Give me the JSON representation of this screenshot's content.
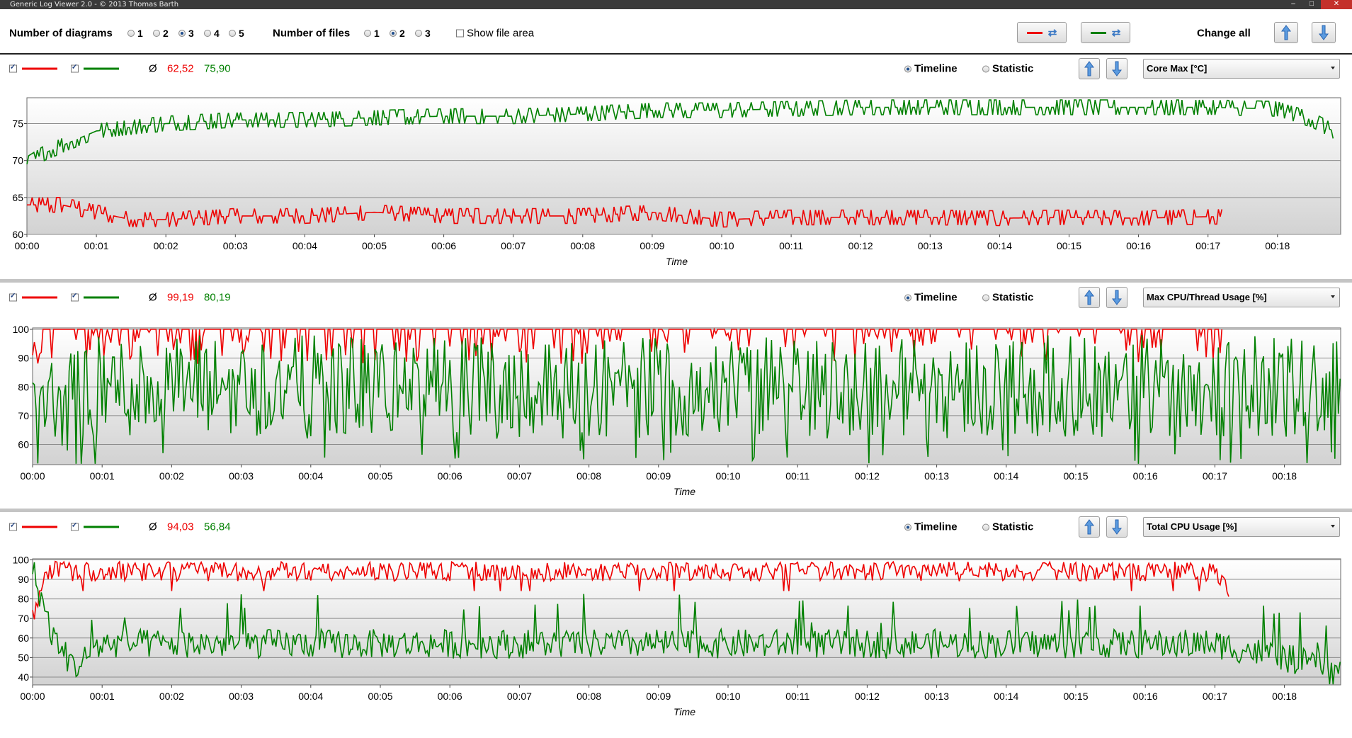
{
  "window": {
    "title": "Generic Log Viewer 2.0 - © 2013 Thomas Barth",
    "minimize": "–",
    "maximize": "□",
    "close": "✕"
  },
  "toolbar": {
    "diagrams_label": "Number of diagrams",
    "diagram_options": [
      "1",
      "2",
      "3",
      "4",
      "5"
    ],
    "diagrams_selected": "3",
    "files_label": "Number of files",
    "file_options": [
      "1",
      "2",
      "3"
    ],
    "files_selected": "2",
    "show_file_area_label": "Show file area",
    "change_all_label": "Change all"
  },
  "colors": {
    "file1": "#ee0000",
    "file2": "#008000",
    "accent": "#3a78c4"
  },
  "panels": [
    {
      "avg_symbol": "Ø",
      "avg1": "62,52",
      "avg2": "75,90",
      "timeline_label": "Timeline",
      "statistic_label": "Statistic",
      "selected_view": "Timeline",
      "metric": "Core Max [°C]",
      "xlabel": "Time"
    },
    {
      "avg_symbol": "Ø",
      "avg1": "99,19",
      "avg2": "80,19",
      "timeline_label": "Timeline",
      "statistic_label": "Statistic",
      "selected_view": "Timeline",
      "metric": "Max CPU/Thread Usage [%]",
      "xlabel": "Time"
    },
    {
      "avg_symbol": "Ø",
      "avg1": "94,03",
      "avg2": "56,84",
      "timeline_label": "Timeline",
      "statistic_label": "Statistic",
      "selected_view": "Timeline",
      "metric": "Total CPU Usage [%]",
      "xlabel": "Time"
    }
  ],
  "chart_data": [
    {
      "type": "line",
      "xlabel": "Time",
      "x_ticks": [
        "00:00",
        "00:01",
        "00:02",
        "00:03",
        "00:04",
        "00:05",
        "00:06",
        "00:07",
        "00:08",
        "00:09",
        "00:10",
        "00:11",
        "00:12",
        "00:13",
        "00:14",
        "00:15",
        "00:16",
        "00:17",
        "00:18"
      ],
      "ylim": [
        60,
        78.5
      ],
      "y_ticks": [
        60,
        65,
        70,
        75
      ],
      "series": [
        {
          "color": "#ee0000",
          "x_minutes": [
            0,
            0.5,
            1,
            1.5,
            2,
            3,
            4,
            5,
            6,
            7,
            8,
            9,
            10,
            11,
            12,
            13,
            14,
            15,
            16,
            17,
            17.2
          ],
          "values": [
            64,
            64,
            63,
            62,
            62,
            62.5,
            62.5,
            63,
            62.5,
            62.5,
            62.5,
            63,
            62,
            62.3,
            62.3,
            62.3,
            62.2,
            62.3,
            62.2,
            62.4,
            62.4
          ]
        },
        {
          "color": "#008000",
          "x_minutes": [
            0,
            0.25,
            0.5,
            0.75,
            1,
            1.5,
            2,
            3,
            4,
            5,
            6,
            7,
            8,
            9,
            10,
            11,
            12,
            13,
            14,
            15,
            16,
            17,
            18,
            18.5,
            18.8
          ],
          "values": [
            69.5,
            71,
            72,
            73,
            74,
            74.5,
            75,
            75.5,
            75.5,
            75.8,
            76,
            76,
            76.3,
            76.8,
            76.8,
            77,
            77.2,
            77.2,
            77.2,
            77.2,
            77.2,
            77.2,
            77,
            75.5,
            74
          ]
        }
      ]
    },
    {
      "type": "line",
      "xlabel": "Time",
      "x_ticks": [
        "00:00",
        "00:01",
        "00:02",
        "00:03",
        "00:04",
        "00:05",
        "00:06",
        "00:07",
        "00:08",
        "00:09",
        "00:10",
        "00:11",
        "00:12",
        "00:13",
        "00:14",
        "00:15",
        "00:16",
        "00:17",
        "00:18"
      ],
      "ylim": [
        53,
        100.5
      ],
      "y_ticks": [
        60,
        70,
        80,
        90,
        100
      ],
      "series": [
        {
          "color": "#ee0000",
          "x_minutes": [
            0,
            0.1,
            0.3,
            1,
            2,
            3,
            4,
            5,
            6,
            7,
            8,
            9,
            10,
            11,
            12,
            13,
            14,
            15,
            16,
            17,
            17.1
          ],
          "values": [
            82,
            95,
            100,
            99,
            99,
            99,
            99,
            99,
            99,
            99,
            99,
            99,
            99,
            99,
            99,
            99,
            99,
            99,
            99,
            99,
            94
          ]
        },
        {
          "color": "#008000",
          "x_minutes": [
            0,
            1,
            2,
            3,
            4,
            5,
            6,
            7,
            8,
            9,
            10,
            11,
            12,
            13,
            14,
            15,
            16,
            17,
            18,
            18.8
          ],
          "values": [
            70,
            80,
            80,
            80,
            80,
            80,
            80,
            80,
            80,
            80,
            80,
            80,
            80,
            80,
            80,
            80,
            80,
            80,
            80,
            80
          ]
        }
      ]
    },
    {
      "type": "line",
      "xlabel": "Time",
      "x_ticks": [
        "00:00",
        "00:01",
        "00:02",
        "00:03",
        "00:04",
        "00:05",
        "00:06",
        "00:07",
        "00:08",
        "00:09",
        "00:10",
        "00:11",
        "00:12",
        "00:13",
        "00:14",
        "00:15",
        "00:16",
        "00:17",
        "00:18"
      ],
      "ylim": [
        36,
        100.5
      ],
      "y_ticks": [
        40,
        50,
        60,
        70,
        80,
        90,
        100
      ],
      "series": [
        {
          "color": "#ee0000",
          "x_minutes": [
            0,
            0.2,
            0.5,
            1,
            2,
            3,
            4,
            5,
            6,
            7,
            8,
            9,
            10,
            11,
            12,
            13,
            14,
            15,
            16,
            17,
            17.2
          ],
          "values": [
            70,
            95,
            94,
            94,
            94,
            94,
            94,
            94,
            94,
            94,
            94,
            94,
            94,
            94,
            94,
            94,
            94,
            94,
            94,
            94,
            84
          ]
        },
        {
          "color": "#008000",
          "x_minutes": [
            0,
            0.3,
            0.6,
            1,
            2,
            3,
            4,
            5,
            6,
            7,
            8,
            9,
            10,
            11,
            12,
            13,
            14,
            15,
            16,
            17,
            18,
            18.8
          ],
          "values": [
            95,
            60,
            45,
            57,
            57,
            57,
            57,
            57,
            57,
            57,
            57,
            57,
            57,
            57,
            57,
            57,
            57,
            57,
            57,
            57,
            50,
            42
          ]
        }
      ]
    }
  ]
}
